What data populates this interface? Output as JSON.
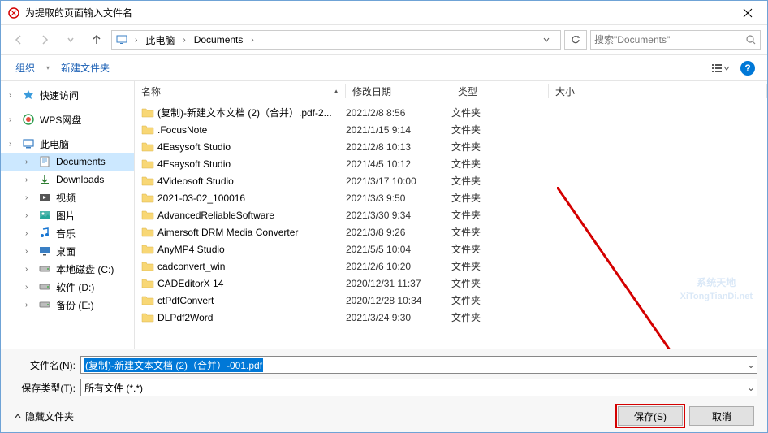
{
  "title": "为提取的页面输入文件名",
  "breadcrumb": {
    "root": "此电脑",
    "folder": "Documents"
  },
  "search": {
    "placeholder": "搜索\"Documents\""
  },
  "toolbar": {
    "organize": "组织",
    "newfolder": "新建文件夹"
  },
  "columns": {
    "name": "名称",
    "date": "修改日期",
    "type": "类型",
    "size": "大小"
  },
  "sidebar": {
    "items": [
      {
        "label": "快速访问",
        "icon": "star",
        "exp": true
      },
      {
        "label": "WPS网盘",
        "icon": "wps",
        "exp": true
      },
      {
        "label": "此电脑",
        "icon": "pc",
        "exp": true
      },
      {
        "label": "Documents",
        "icon": "doc",
        "indent": 1,
        "selected": true,
        "exp": true
      },
      {
        "label": "Downloads",
        "icon": "down",
        "indent": 1,
        "exp": true
      },
      {
        "label": "视频",
        "icon": "video",
        "indent": 1,
        "exp": true
      },
      {
        "label": "图片",
        "icon": "pic",
        "indent": 1,
        "exp": true
      },
      {
        "label": "音乐",
        "icon": "music",
        "indent": 1,
        "exp": true
      },
      {
        "label": "桌面",
        "icon": "desktop",
        "indent": 1,
        "exp": true
      },
      {
        "label": "本地磁盘 (C:)",
        "icon": "drive",
        "indent": 1,
        "exp": true
      },
      {
        "label": "软件 (D:)",
        "icon": "drive",
        "indent": 1,
        "exp": true
      },
      {
        "label": "备份 (E:)",
        "icon": "drive",
        "indent": 1,
        "exp": true
      }
    ]
  },
  "files": [
    {
      "name": "(复制)-新建文本文档 (2)（合并）.pdf-2...",
      "date": "2021/2/8 8:56",
      "type": "文件夹"
    },
    {
      "name": ".FocusNote",
      "date": "2021/1/15 9:14",
      "type": "文件夹"
    },
    {
      "name": "4Easysoft Studio",
      "date": "2021/2/8 10:13",
      "type": "文件夹"
    },
    {
      "name": "4Esaysoft Studio",
      "date": "2021/4/5 10:12",
      "type": "文件夹"
    },
    {
      "name": "4Videosoft Studio",
      "date": "2021/3/17 10:00",
      "type": "文件夹"
    },
    {
      "name": "2021-03-02_100016",
      "date": "2021/3/3 9:50",
      "type": "文件夹"
    },
    {
      "name": "AdvancedReliableSoftware",
      "date": "2021/3/30 9:34",
      "type": "文件夹"
    },
    {
      "name": "Aimersoft DRM Media Converter",
      "date": "2021/3/8 9:26",
      "type": "文件夹"
    },
    {
      "name": "AnyMP4 Studio",
      "date": "2021/5/5 10:04",
      "type": "文件夹"
    },
    {
      "name": "cadconvert_win",
      "date": "2021/2/6 10:20",
      "type": "文件夹"
    },
    {
      "name": "CADEditorX 14",
      "date": "2020/12/31 11:37",
      "type": "文件夹"
    },
    {
      "name": "ctPdfConvert",
      "date": "2020/12/28 10:34",
      "type": "文件夹"
    },
    {
      "name": "DLPdf2Word",
      "date": "2021/3/24 9:30",
      "type": "文件夹"
    }
  ],
  "form": {
    "filename_label": "文件名(N):",
    "filename_value": "(复制)-新建文本文档 (2)（合并）-001.pdf",
    "type_label": "保存类型(T):",
    "type_value": "所有文件 (*.*)",
    "hide_folders": "隐藏文件夹",
    "save": "保存(S)",
    "cancel": "取消"
  },
  "watermark": {
    "line1": "系统天地",
    "line2": "XiTongTianDi.net"
  }
}
